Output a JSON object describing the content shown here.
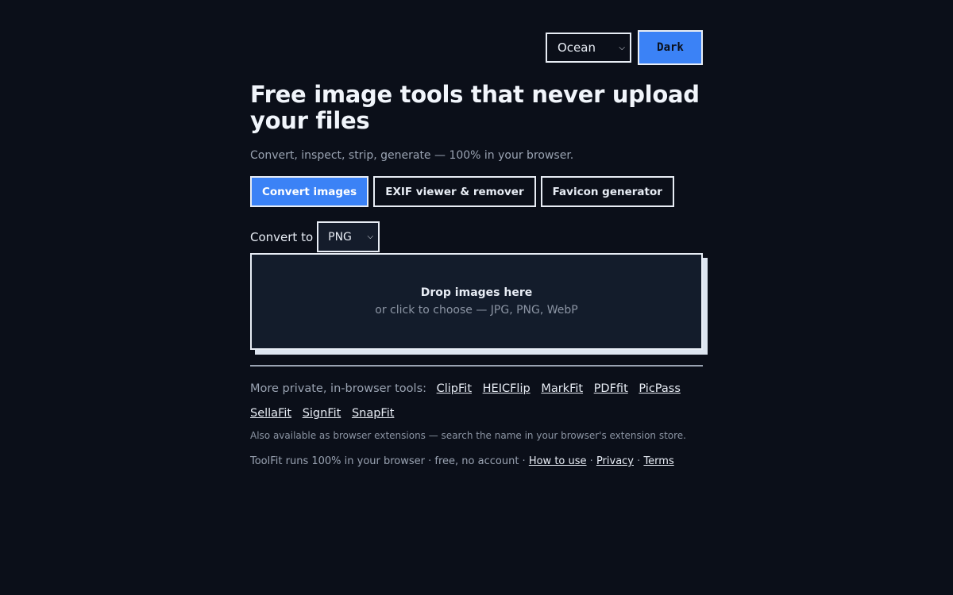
{
  "header": {
    "theme_select_value": "Ocean",
    "dark_button_label": "Dark"
  },
  "hero": {
    "title": "Free image tools that never upload your files",
    "subtitle": "Convert, inspect, strip, generate — 100% in your browser."
  },
  "tabs": [
    {
      "label": "Convert images",
      "active": true
    },
    {
      "label": "EXIF viewer & remover",
      "active": false
    },
    {
      "label": "Favicon generator",
      "active": false
    }
  ],
  "converter": {
    "label": "Convert to",
    "format_value": "PNG",
    "dropzone_title": "Drop images here",
    "dropzone_subtitle": "or click to choose — JPG, PNG, WebP"
  },
  "more_tools": {
    "label": "More private, in-browser tools:",
    "links": [
      "ClipFit",
      "HEICFlip",
      "MarkFit",
      "PDFfit",
      "PicPass",
      "SellaFit",
      "SignFit",
      "SnapFit"
    ],
    "extension_note": "Also available as browser extensions — search the name in your browser's extension store."
  },
  "footer": {
    "text": "ToolFit runs 100% in your browser · free, no account ·",
    "sep": "·",
    "how_to_use": "How to use",
    "privacy": "Privacy",
    "terms": "Terms"
  },
  "icons": {
    "select_chevron": "chevron-down-icon"
  },
  "colors": {
    "background": "#0b0f19",
    "accent": "#3b82f6",
    "text": "#e8edf5",
    "muted": "#9aa3b2",
    "dropzone": "#131c2b"
  }
}
